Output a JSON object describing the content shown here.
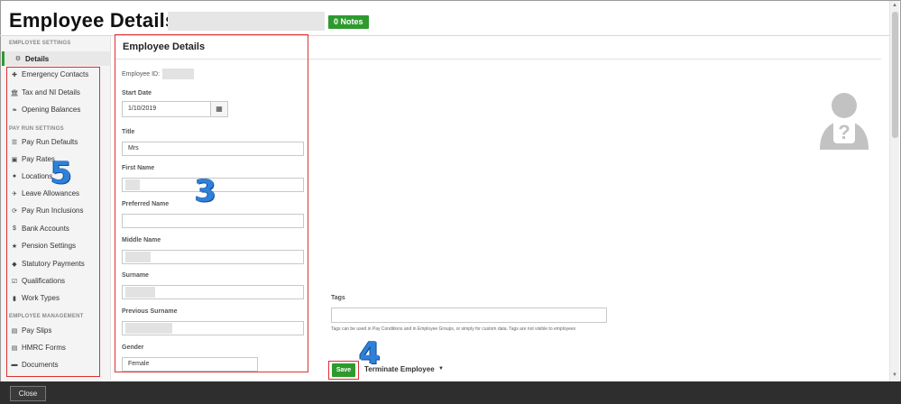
{
  "header": {
    "title": "Employee Details for",
    "notes_badge": "0 Notes"
  },
  "sidebar": {
    "employee_settings": {
      "heading": "EMPLOYEE SETTINGS",
      "items": [
        {
          "label": "Details",
          "icon": "gear-icon",
          "active": true
        },
        {
          "label": "Emergency Contacts",
          "icon": "plus-icon"
        },
        {
          "label": "Tax and NI Details",
          "icon": "bank-icon"
        },
        {
          "label": "Opening Balances",
          "icon": "leaf-icon"
        }
      ]
    },
    "pay_run_settings": {
      "heading": "PAY RUN SETTINGS",
      "items": [
        {
          "label": "Pay Run Defaults",
          "icon": "list-icon"
        },
        {
          "label": "Pay Rates",
          "icon": "money-icon"
        },
        {
          "label": "Locations",
          "icon": "globe-icon"
        },
        {
          "label": "Leave Allowances",
          "icon": "plane-icon"
        },
        {
          "label": "Pay Run Inclusions",
          "icon": "refresh-icon"
        },
        {
          "label": "Bank Accounts",
          "icon": "dollar-icon"
        },
        {
          "label": "Pension Settings",
          "icon": "star-icon"
        },
        {
          "label": "Statutory Payments",
          "icon": "tag-icon"
        },
        {
          "label": "Qualifications",
          "icon": "checkbox-icon"
        },
        {
          "label": "Work Types",
          "icon": "book-icon"
        }
      ]
    },
    "employee_management": {
      "heading": "EMPLOYEE MANAGEMENT",
      "items": [
        {
          "label": "Pay Slips",
          "icon": "file-icon"
        },
        {
          "label": "HMRC Forms",
          "icon": "file-icon"
        },
        {
          "label": "Documents",
          "icon": "folder-icon"
        }
      ]
    }
  },
  "form": {
    "title": "Employee Details",
    "employee_id_label": "Employee ID:",
    "start_date_label": "Start Date",
    "start_date_value": "1/10/2019",
    "title_label": "Title",
    "title_value": "Mrs",
    "first_name_label": "First Name",
    "preferred_name_label": "Preferred Name",
    "middle_name_label": "Middle Name",
    "surname_label": "Surname",
    "previous_surname_label": "Previous Surname",
    "gender_label": "Gender",
    "gender_value": "Female"
  },
  "tags": {
    "label": "Tags",
    "help": "Tags can be used in Pay Conditions and in Employee Groups, or simply for custom data. Tags are not visible to employees"
  },
  "actions": {
    "save": "Save",
    "terminate": "Terminate Employee"
  },
  "footer": {
    "close": "Close"
  },
  "annotations": {
    "three": "3",
    "four": "4",
    "five": "5"
  },
  "colors": {
    "accent_green": "#2e9a2e",
    "highlight_red": "#e03030",
    "annotation_blue": "#2f80d8"
  }
}
